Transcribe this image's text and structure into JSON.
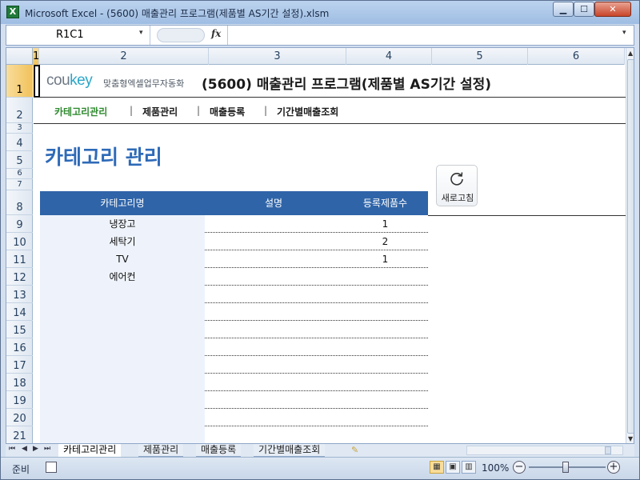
{
  "window": {
    "title": "Microsoft Excel - (5600) 매출관리 프로그램(제품별 AS기간 설정).xlsm",
    "app_icon": "X",
    "min_icon": "▁",
    "max_icon": "☐",
    "close_icon": "✕"
  },
  "formula_bar": {
    "name_box": "R1C1",
    "name_arrow": "▾",
    "fx": "fx",
    "formula": "",
    "expand_arrow": "▾"
  },
  "columns": [
    {
      "label": "1",
      "selected": true
    },
    {
      "label": "2",
      "selected": false
    },
    {
      "label": "3",
      "selected": false
    },
    {
      "label": "4",
      "selected": false
    },
    {
      "label": "5",
      "selected": false
    },
    {
      "label": "6",
      "selected": false
    }
  ],
  "rows": [
    "1",
    "2",
    "3",
    "4",
    "5",
    "6",
    "7",
    "8",
    "9",
    "10",
    "11",
    "12",
    "13",
    "14",
    "15",
    "16",
    "17",
    "18",
    "19",
    "20",
    "21"
  ],
  "banner": {
    "logo_main": "cou",
    "logo_key": "key",
    "logo_sub": "맞춤형엑셀업무자동화",
    "title": "(5600) 매출관리 프로그램(제품별 AS기간 설정)"
  },
  "menu": {
    "items": [
      "카테고리관리",
      "제품관리",
      "매출등록",
      "기간별매출조회"
    ],
    "separator": "|"
  },
  "section_title": "카테고리 관리",
  "refresh": {
    "label": "새로고침",
    "icon": "refresh-icon"
  },
  "table": {
    "headers": [
      "카테고리명",
      "설명",
      "등록제품수"
    ],
    "rows": [
      [
        "냉장고",
        "",
        "1"
      ],
      [
        "세탁기",
        "",
        "2"
      ],
      [
        "TV",
        "",
        "1"
      ],
      [
        "에어컨",
        "",
        ""
      ],
      [
        "",
        "",
        ""
      ],
      [
        "",
        "",
        ""
      ],
      [
        "",
        "",
        ""
      ],
      [
        "",
        "",
        ""
      ],
      [
        "",
        "",
        ""
      ],
      [
        "",
        "",
        ""
      ],
      [
        "",
        "",
        ""
      ],
      [
        "",
        "",
        ""
      ],
      [
        "",
        "",
        ""
      ]
    ]
  },
  "sheet_tabs": {
    "tabs": [
      "카테고리관리",
      "제품관리",
      "매출등록",
      "기간별매출조회"
    ],
    "active": 0,
    "nav": [
      "⏮",
      "◀",
      "▶",
      "⏭"
    ],
    "new_sheet_icon": "✎"
  },
  "scrollbar": {
    "up": "▲",
    "down": "▼",
    "right_arrow": "▶"
  },
  "status": {
    "mode": "준비",
    "zoom": "100%",
    "zoom_out": "−",
    "zoom_in": "+",
    "views": [
      "▦",
      "▣",
      "▥"
    ]
  }
}
